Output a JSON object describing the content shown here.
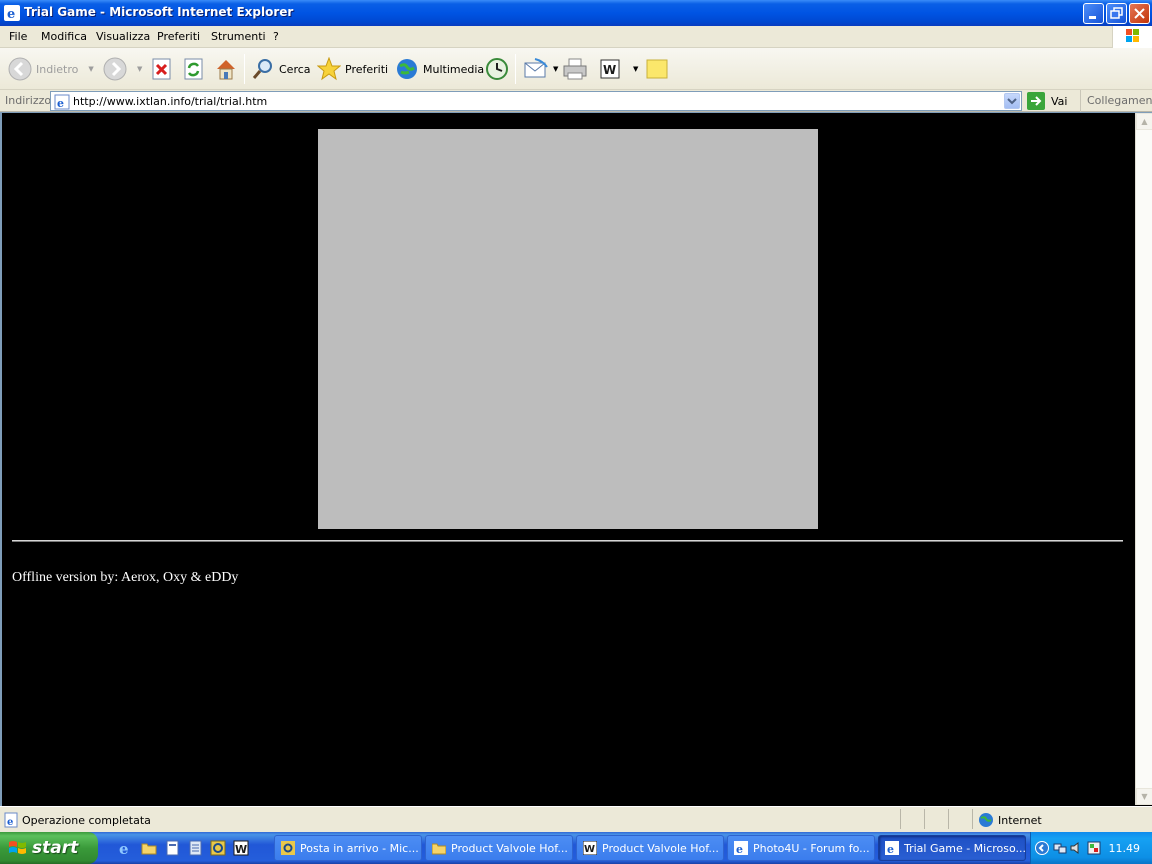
{
  "window": {
    "title": "Trial Game - Microsoft Internet Explorer"
  },
  "menu": {
    "items": [
      "File",
      "Modifica",
      "Visualizza",
      "Preferiti",
      "Strumenti",
      "?"
    ]
  },
  "toolbar": {
    "back_label": "Indietro",
    "search_label": "Cerca",
    "favorites_label": "Preferiti",
    "media_label": "Multimedia"
  },
  "address": {
    "label": "Indirizzo",
    "url": "http://www.ixtlan.info/trial/trial.htm",
    "go_label": "Vai",
    "links_label": "Collegamenti"
  },
  "page": {
    "credit": "Offline version by: Aerox, Oxy & eDDy"
  },
  "status": {
    "text": "Operazione completata",
    "zone": "Internet"
  },
  "taskbar": {
    "start_label": "start",
    "tasks": [
      {
        "label": "Posta in arrivo - Mic...",
        "active": false
      },
      {
        "label": "Product Valvole Hof...",
        "active": false
      },
      {
        "label": "Product Valvole Hof...",
        "active": false
      },
      {
        "label": "Photo4U - Forum fo...",
        "active": false
      },
      {
        "label": "Trial Game - Microso...",
        "active": true
      }
    ],
    "clock": "11.49"
  },
  "colors": {
    "titlebar": "#0054e3",
    "chrome": "#ece9d8",
    "page_background": "#000000",
    "game_frame": "#bdbdbd",
    "start_green": "#3a9a3a",
    "taskbar_blue": "#245edb"
  }
}
